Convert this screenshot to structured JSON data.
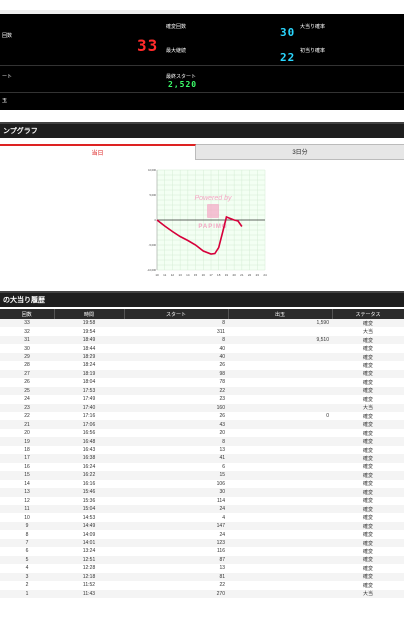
{
  "stats": {
    "label_count": "回数",
    "label_kakuhen_count": "確変回数",
    "value_kakuhen_count": "33",
    "label_max_streak": "最大継続",
    "label_big_prob": "大当り確率",
    "value_big_prob": "30",
    "label_first_prob": "初当り確率",
    "value_first_prob": "22",
    "label_start": "ート",
    "label_final_start": "最終スタート",
    "value_final_start": "2,520",
    "label_dama": "玉"
  },
  "graph_section": {
    "title": "ンプグラフ",
    "tab_today": "当日",
    "tab_3days": "3日分",
    "watermark_line1": "Powered by",
    "watermark_line2": "PAPIMO",
    "y_ticks": [
      "10,000",
      "5,000",
      "0",
      "-5,000",
      "-10,000"
    ],
    "x_ticks": [
      "10",
      "11",
      "12",
      "13",
      "14",
      "15",
      "16",
      "17",
      "18",
      "19",
      "20",
      "21",
      "22",
      "23",
      "24"
    ]
  },
  "chart_data": {
    "type": "line",
    "title": "",
    "xlabel": "",
    "ylabel": "",
    "ylim": [
      -10000,
      10000
    ],
    "xlim": [
      10,
      24
    ],
    "grid": true,
    "series": [
      {
        "color": "#d6003a",
        "x": [
          10,
          11,
          12,
          13,
          14,
          15,
          16,
          17,
          17.5,
          18,
          18.5,
          19,
          19.5,
          20,
          20.5,
          21
        ],
        "y": [
          0,
          -1200,
          -2300,
          -3300,
          -4100,
          -5000,
          -6200,
          -6800,
          -6700,
          -5500,
          -2500,
          600,
          300,
          0,
          -200,
          -1300
        ]
      }
    ]
  },
  "history": {
    "title": "の大当り履歴",
    "columns": [
      "回数",
      "時間",
      "スタート",
      "出玉",
      "ステータス"
    ],
    "rows": [
      [
        "33",
        "19:58",
        "8",
        "1,590",
        "確変"
      ],
      [
        "32",
        "19:54",
        "311",
        "",
        "大当"
      ],
      [
        "31",
        "18:49",
        "8",
        "9,510",
        "確変"
      ],
      [
        "30",
        "18:44",
        "40",
        "",
        "確変"
      ],
      [
        "29",
        "18:29",
        "40",
        "",
        "確変"
      ],
      [
        "28",
        "18:24",
        "26",
        "",
        "確変"
      ],
      [
        "27",
        "18:19",
        "98",
        "",
        "確変"
      ],
      [
        "26",
        "18:04",
        "78",
        "",
        "確変"
      ],
      [
        "25",
        "17:53",
        "22",
        "",
        "確変"
      ],
      [
        "24",
        "17:49",
        "23",
        "",
        "確変"
      ],
      [
        "23",
        "17:40",
        "160",
        "",
        "大当"
      ],
      [
        "22",
        "17:16",
        "26",
        "0",
        "確変"
      ],
      [
        "21",
        "17:06",
        "43",
        "",
        "確変"
      ],
      [
        "20",
        "16:56",
        "20",
        "",
        "確変"
      ],
      [
        "19",
        "16:48",
        "8",
        "",
        "確変"
      ],
      [
        "18",
        "16:43",
        "13",
        "",
        "確変"
      ],
      [
        "17",
        "16:38",
        "41",
        "",
        "確変"
      ],
      [
        "16",
        "16:24",
        "6",
        "",
        "確変"
      ],
      [
        "15",
        "16:22",
        "15",
        "",
        "確変"
      ],
      [
        "14",
        "16:16",
        "106",
        "",
        "確変"
      ],
      [
        "13",
        "15:46",
        "30",
        "",
        "確変"
      ],
      [
        "12",
        "15:36",
        "114",
        "",
        "確変"
      ],
      [
        "11",
        "15:04",
        "24",
        "",
        "確変"
      ],
      [
        "10",
        "14:53",
        "4",
        "",
        "確変"
      ],
      [
        "9",
        "14:49",
        "147",
        "",
        "確変"
      ],
      [
        "8",
        "14:09",
        "24",
        "",
        "確変"
      ],
      [
        "7",
        "14:01",
        "123",
        "",
        "確変"
      ],
      [
        "6",
        "13:24",
        "116",
        "",
        "確変"
      ],
      [
        "5",
        "12:51",
        "87",
        "",
        "確変"
      ],
      [
        "4",
        "12:28",
        "13",
        "",
        "確変"
      ],
      [
        "3",
        "12:18",
        "81",
        "",
        "確変"
      ],
      [
        "2",
        "11:52",
        "22",
        "",
        "確変"
      ],
      [
        "1",
        "11:43",
        "270",
        "",
        "大当"
      ]
    ]
  }
}
